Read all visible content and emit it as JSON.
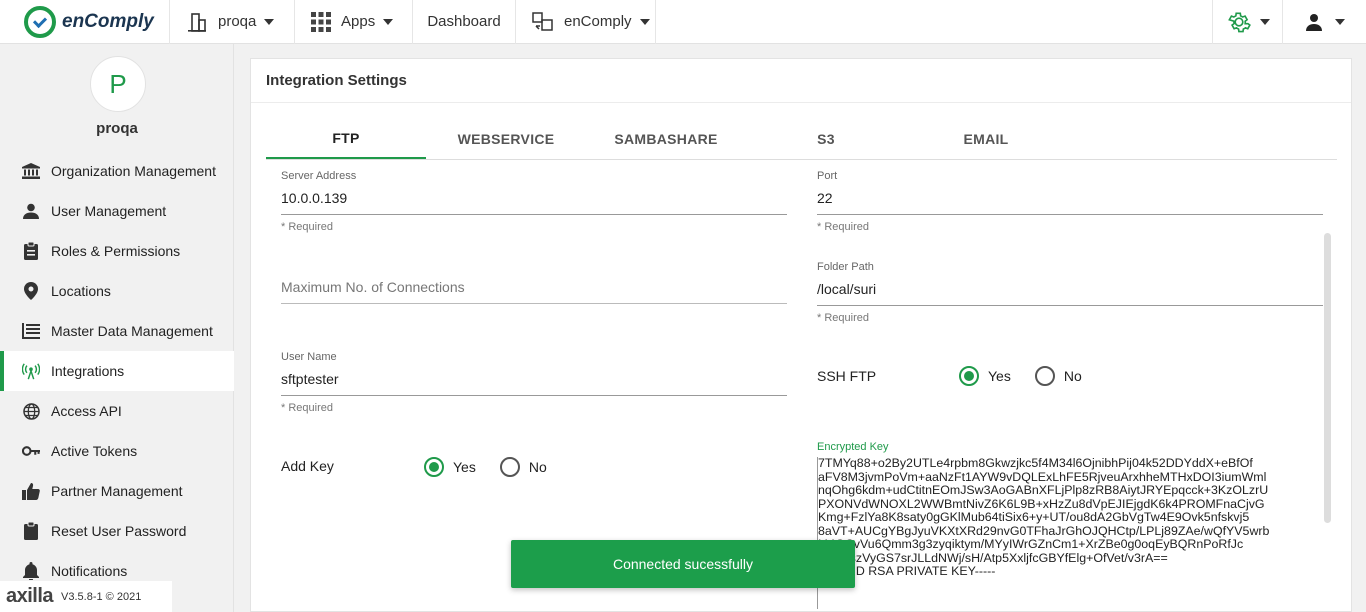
{
  "header": {
    "brand": "enComply",
    "org_selector": "proqa",
    "apps_label": "Apps",
    "dashboard_label": "Dashboard",
    "product_selector": "enComply"
  },
  "sidebar": {
    "avatar_initial": "P",
    "org_name": "proqa",
    "items": [
      {
        "label": "Organization Management",
        "icon": "bank-icon"
      },
      {
        "label": "User Management",
        "icon": "user-icon"
      },
      {
        "label": "Roles & Permissions",
        "icon": "clipboard-icon"
      },
      {
        "label": "Locations",
        "icon": "location-pin-icon"
      },
      {
        "label": "Master Data Management",
        "icon": "data-grid-icon"
      },
      {
        "label": "Integrations",
        "icon": "antenna-icon"
      },
      {
        "label": "Access API",
        "icon": "globe-icon"
      },
      {
        "label": "Active Tokens",
        "icon": "key-icon"
      },
      {
        "label": "Partner Management",
        "icon": "thumbs-up-icon"
      },
      {
        "label": "Reset User Password",
        "icon": "reset-icon"
      },
      {
        "label": "Notifications",
        "icon": "bell-icon"
      }
    ],
    "active_item": "Integrations",
    "footer_brand": "axilla",
    "footer_version": "V3.5.8-1 © 2021"
  },
  "panel": {
    "title": "Integration Settings",
    "tabs": [
      "FTP",
      "WEBSERVICE",
      "SAMBASHARE",
      "S3",
      "EMAIL"
    ],
    "active_tab": "FTP"
  },
  "form": {
    "server_address": {
      "label": "Server Address",
      "value": "10.0.0.139",
      "hint": "* Required"
    },
    "port": {
      "label": "Port",
      "value": "22",
      "hint": "* Required"
    },
    "max_connections": {
      "placeholder": "Maximum No. of Connections"
    },
    "folder_path": {
      "label": "Folder Path",
      "value": "/local/suri",
      "hint": "* Required"
    },
    "user_name": {
      "label": "User Name",
      "value": "sftptester",
      "hint": "* Required"
    },
    "ssh_ftp": {
      "label": "SSH FTP",
      "yes": "Yes",
      "no": "No",
      "selected": "Yes"
    },
    "add_key": {
      "label": "Add Key",
      "yes": "Yes",
      "no": "No",
      "selected": "Yes"
    },
    "encrypted_key": {
      "label": "Encrypted Key",
      "value": "7TMYq88+o2By2UTLe4rpbm8Gkwzjkc5f4M34l6OjnibhPij04k52DDYddX+eBfOf\naFV8M3jvmPoVm+aaNzFt1AYW9vDQLExLhFE5RjveuArxhheMTHxDOI3iumWml\nnqOhg6kdm+udCtitnEOmJSw3AoGABnXFLjPlp8zRB8AiytJRYEpqcck+3KzOLzrU\nPXONVdWNOXL2WWBmtNivZ6K6L9B+xHzZu8dVpEJIEjgdK6k4PROMFnaCjvG\nKmg+FzlYa8K8saty0gGKlMub64tiSix6+y+UT/ou8dA2GbVgTw4E9Ovk5nfskvj5\n8aVT+AUCgYBgJyuVKXtXRd29nvG0TFhaJrGhOJQHCtp/LPLj89ZAe/wQfYV5wrb\nI44QCvVu6Qmm3g3zyqiktym/MYyIWrGZnCm1+XrZBe0g0oqEyBQRnPoRfJc\n3HR5szVyGS7srJLLdNWj/sH/Atp5XxljfcGBYfElg+OfVet/v3rA==\n-----END RSA PRIVATE KEY-----"
    }
  },
  "toast": {
    "message": "Connected sucessfully"
  },
  "colors": {
    "accent": "#1f9a4a",
    "toast": "#1c9e4b"
  }
}
